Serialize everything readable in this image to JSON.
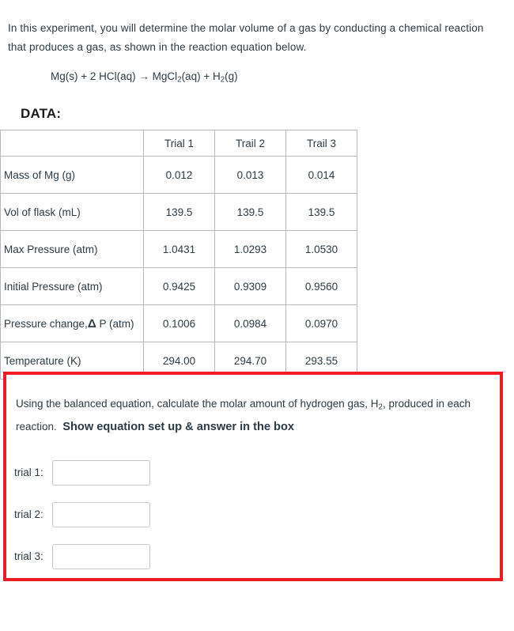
{
  "intro": {
    "paragraph": "In this experiment, you will determine the molar volume of a gas by conducting a chemical reaction that produces a gas, as shown in the reaction equation below.",
    "equation_parts": {
      "p1": "Mg(s) + 2 HCl(aq) → MgCl",
      "sub1": "2",
      "p2": "(aq) + H",
      "sub2": "2",
      "p3": "(g)"
    }
  },
  "data_section": {
    "heading": "DATA:",
    "table": {
      "corner_header": "",
      "columns": [
        "Trial 1",
        "Trail 2",
        "Trail 3"
      ],
      "rows": [
        {
          "label": "Mass of Mg (g)",
          "values": [
            "0.012",
            "0.013",
            "0.014"
          ]
        },
        {
          "label": "Vol of flask (mL)",
          "values": [
            "139.5",
            "139.5",
            "139.5"
          ]
        },
        {
          "label": "Max Pressure (atm)",
          "values": [
            "1.0431",
            "1.0293",
            "1.0530"
          ]
        },
        {
          "label": "Initial Pressure (atm)",
          "values": [
            "0.9425",
            "0.9309",
            "0.9560"
          ]
        },
        {
          "label_pre": "Pressure change,",
          "label_delta": "Δ",
          "label_post": " P (atm)",
          "label": "Pressure change,Δ P (atm)",
          "values": [
            "0.1006",
            "0.0984",
            "0.0970"
          ]
        },
        {
          "label": "Temperature (K)",
          "values": [
            "294.00",
            "294.70",
            "293.55"
          ]
        }
      ]
    }
  },
  "question": {
    "prompt_part1": "Using the balanced equation, calculate the molar amount of hydrogen gas, H",
    "prompt_sub": "2",
    "prompt_part2": ", produced in each reaction.  ",
    "prompt_emphasis": "Show equation set up & answer in the box",
    "border_color": "#ED1C24",
    "answers": [
      {
        "label": "trial 1:",
        "value": "",
        "placeholder": ""
      },
      {
        "label": "trial 2:",
        "value": "",
        "placeholder": ""
      },
      {
        "label": "trial 3:",
        "value": "",
        "placeholder": ""
      }
    ]
  }
}
